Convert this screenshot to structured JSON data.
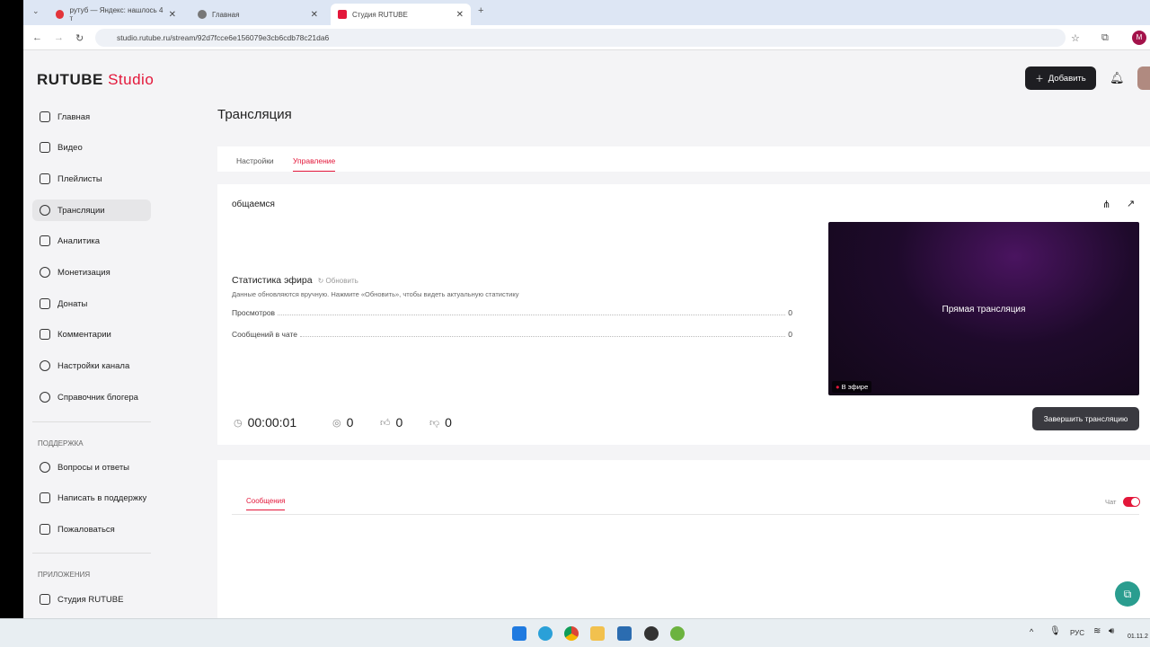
{
  "browser": {
    "tabs": [
      {
        "label": "рутуб — Яндекс: нашлось 4 т"
      },
      {
        "label": "Главная"
      },
      {
        "label": "Студия RUTUBE"
      }
    ],
    "url": "studio.rutube.ru/stream/92d7fcce6e156079e3cb6cdb78c21da6",
    "profile": "M"
  },
  "logo": {
    "brand": "RUTUBE",
    "product": "Studio"
  },
  "header": {
    "add_label": "Добавить"
  },
  "sidebar": {
    "items": [
      {
        "label": "Главная"
      },
      {
        "label": "Видео"
      },
      {
        "label": "Плейлисты"
      },
      {
        "label": "Трансляции"
      },
      {
        "label": "Аналитика"
      },
      {
        "label": "Монетизация"
      },
      {
        "label": "Донаты"
      },
      {
        "label": "Комментарии"
      },
      {
        "label": "Настройки канала"
      },
      {
        "label": "Справочник блогера"
      }
    ],
    "support_title": "ПОДДЕРЖКА",
    "support": [
      {
        "label": "Вопросы и ответы"
      },
      {
        "label": "Написать в поддержку"
      },
      {
        "label": "Пожаловаться"
      }
    ],
    "apps_title": "ПРИЛОЖЕНИЯ",
    "apps": [
      {
        "label": "Студия RUTUBE"
      }
    ]
  },
  "main": {
    "title": "Трансляция",
    "tabs": [
      {
        "label": "Настройки"
      },
      {
        "label": "Управление"
      }
    ],
    "stream_name": "общаемся",
    "stats": {
      "title": "Статистика эфира",
      "refresh": "Обновить",
      "hint": "Данные обновляются вручную. Нажмите «Обновить», чтобы видеть актуальную статистику",
      "rows": [
        {
          "label": "Просмотров",
          "value": "0"
        },
        {
          "label": "Сообщений в чате",
          "value": "0"
        }
      ]
    },
    "preview": {
      "label": "Прямая трансляция",
      "badge": "В эфире"
    },
    "counters": {
      "duration": "00:00:01",
      "viewers": "0",
      "likes": "0",
      "dislikes": "0"
    },
    "end_button": "Завершить трансляцию",
    "chat": {
      "tab": "Сообщения",
      "toggle_label": "Чат",
      "enabled": true
    }
  },
  "taskbar": {
    "lang": "РУС",
    "date": "01.11.2"
  },
  "colors": {
    "accent": "#e3173a"
  }
}
